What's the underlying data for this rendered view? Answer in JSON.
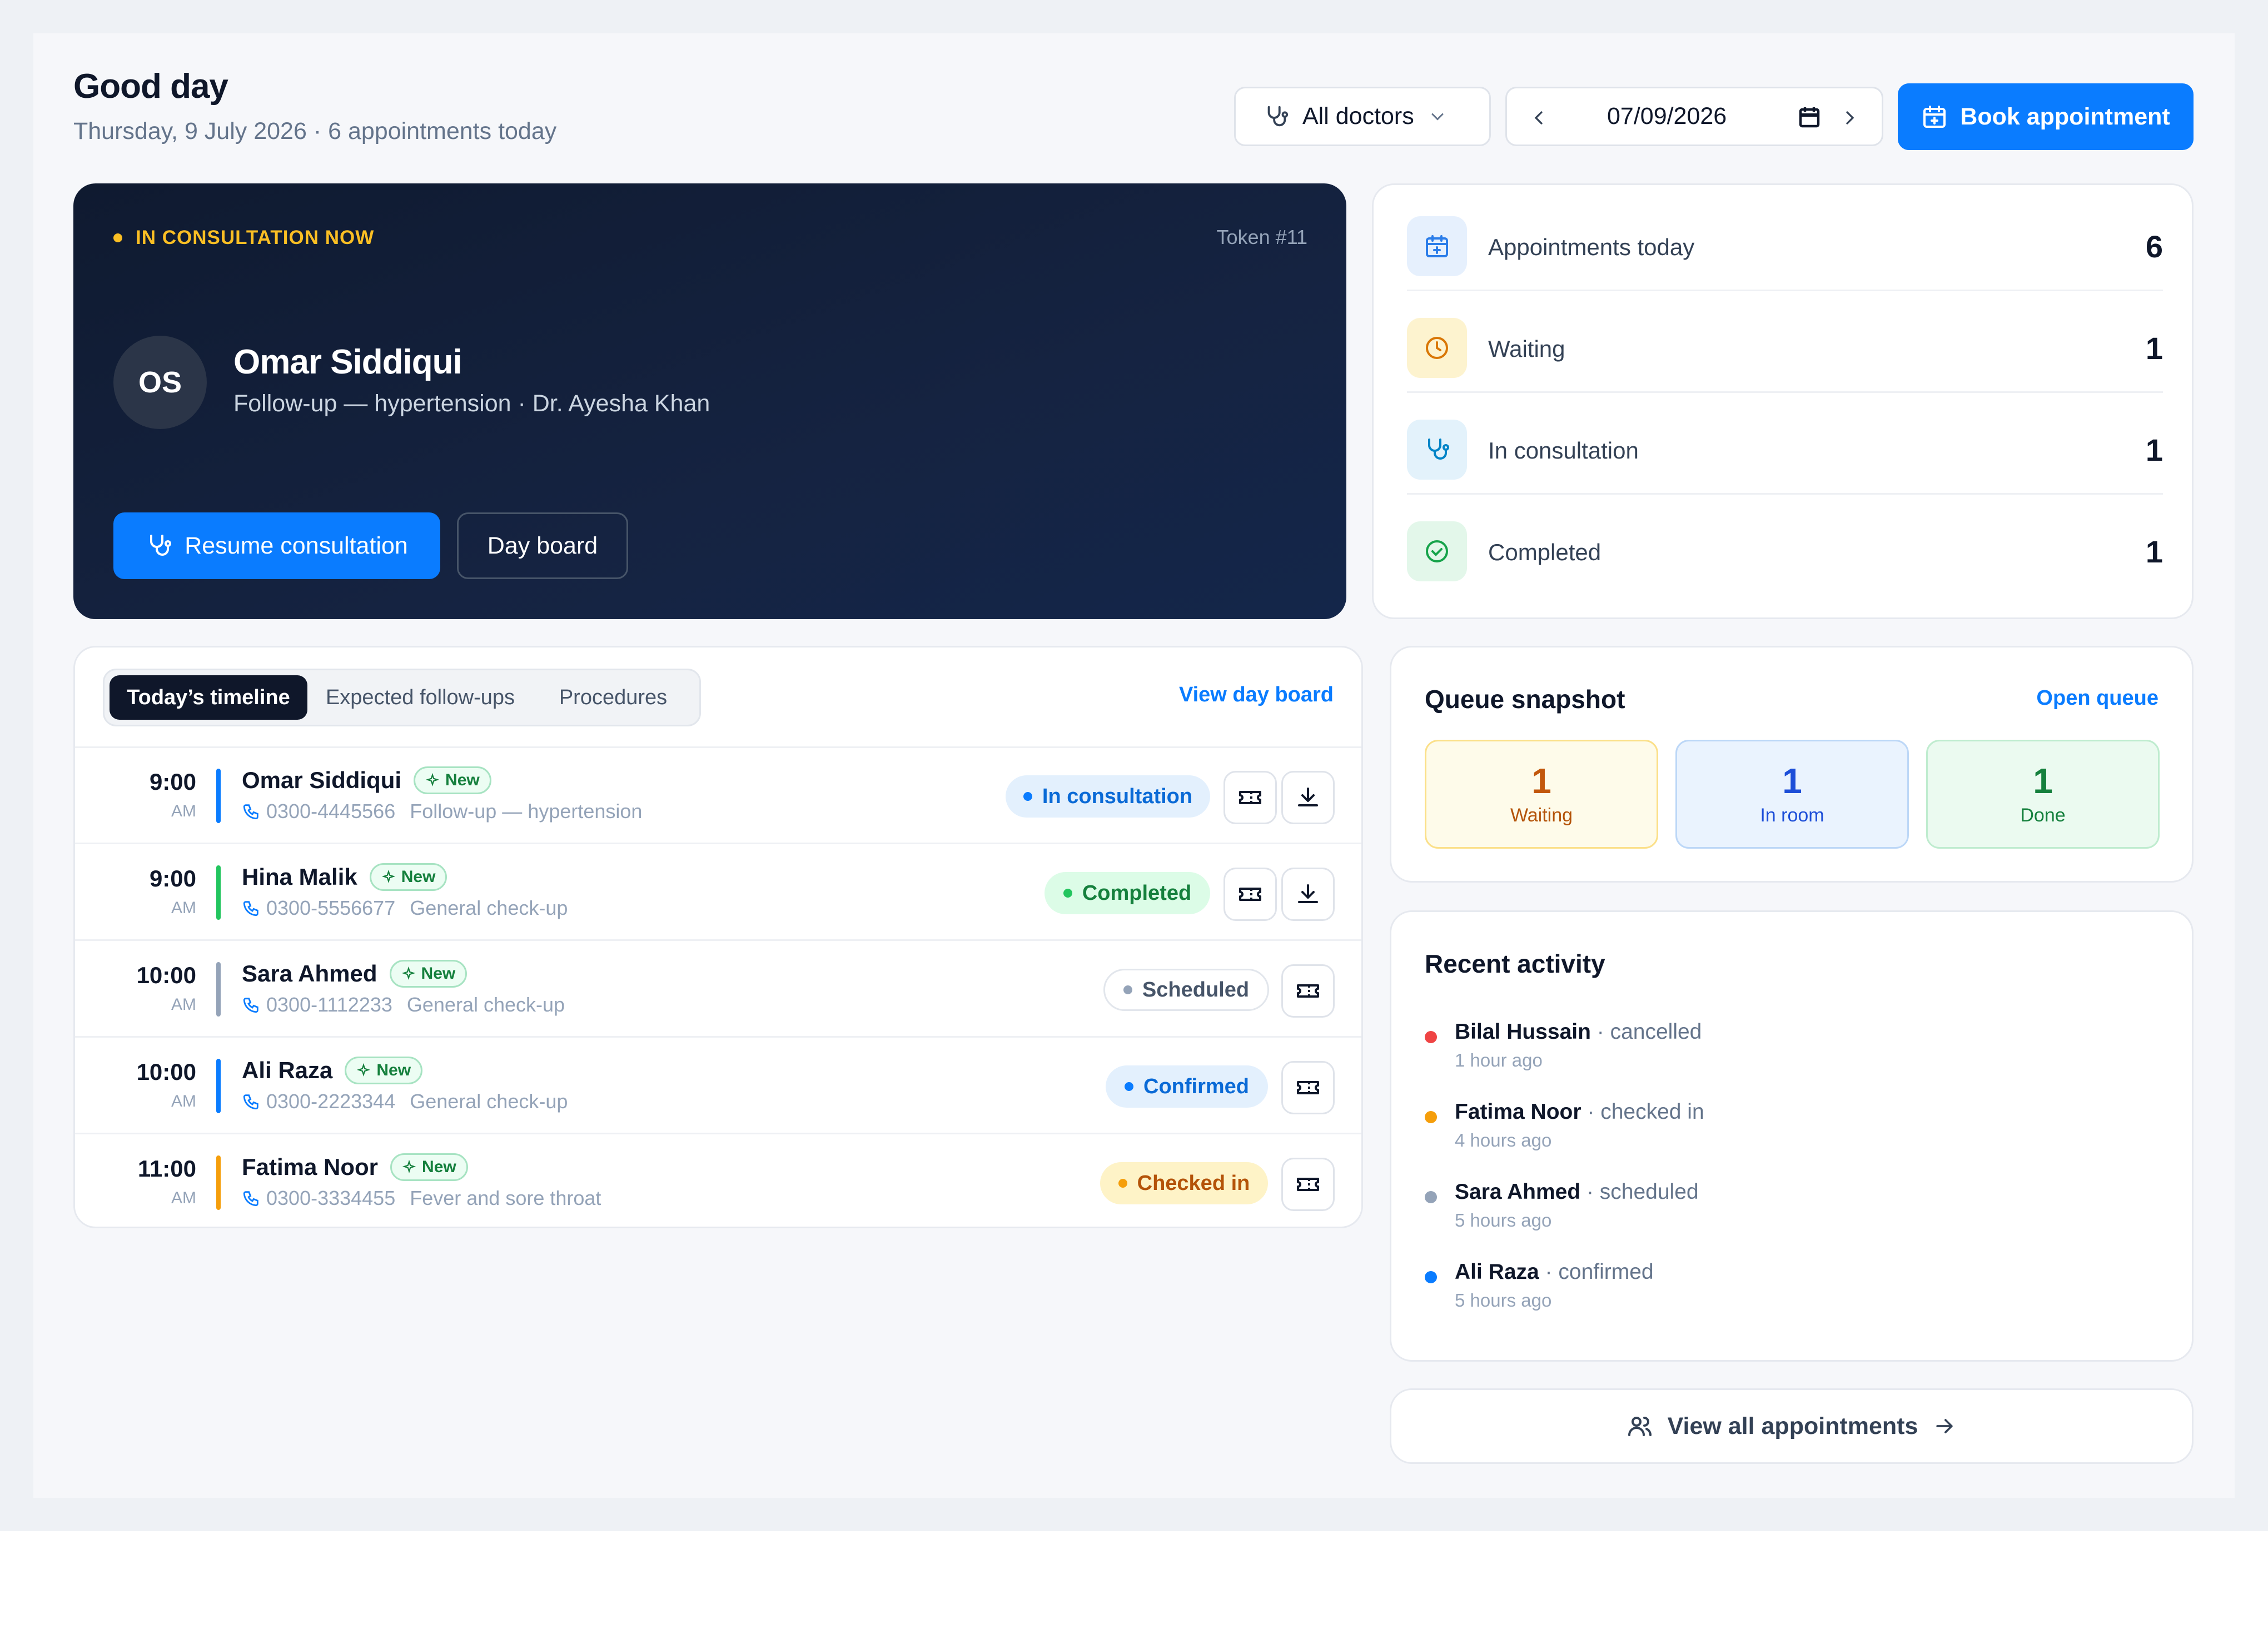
{
  "header": {
    "greeting": "Good day",
    "subtitle": "Thursday, 9 July 2026 · 6 appointments today",
    "doctor_filter": "All doctors",
    "date": "07/09/2026",
    "book_label": "Book appointment"
  },
  "current": {
    "status_label": "IN CONSULTATION NOW",
    "token": "Token #11",
    "initials": "OS",
    "name": "Omar Siddiqui",
    "description": "Follow-up — hypertension · Dr. Ayesha Khan",
    "resume_label": "Resume consultation",
    "dayboard_label": "Day board"
  },
  "stats": [
    {
      "label": "Appointments today",
      "value": "6",
      "icon": "calendar-plus-icon",
      "color": "#2b7de9"
    },
    {
      "label": "Waiting",
      "value": "1",
      "icon": "clock-icon",
      "color": "#d97706"
    },
    {
      "label": "In consultation",
      "value": "1",
      "icon": "stethoscope-icon",
      "color": "#0284c7"
    },
    {
      "label": "Completed",
      "value": "1",
      "icon": "check-circle-icon",
      "color": "#16a34a"
    }
  ],
  "timeline": {
    "tabs": [
      "Today’s timeline",
      "Expected follow-ups",
      "Procedures"
    ],
    "active_tab": "Today’s timeline",
    "view_day_board": "View day board",
    "new_label": "New",
    "rows": [
      {
        "time": "9:00",
        "ampm": "AM",
        "name": "Omar Siddiqui",
        "phone": "0300-4445566",
        "reason": "Follow-up — hypertension",
        "status": "In consultation",
        "bar_color": "#0a7cff",
        "download": true
      },
      {
        "time": "9:00",
        "ampm": "AM",
        "name": "Hina Malik",
        "phone": "0300-5556677",
        "reason": "General check-up",
        "status": "Completed",
        "bar_color": "#22c55e",
        "download": true
      },
      {
        "time": "10:00",
        "ampm": "AM",
        "name": "Sara Ahmed",
        "phone": "0300-1112233",
        "reason": "General check-up",
        "status": "Scheduled",
        "bar_color": "#94a3b8",
        "download": false
      },
      {
        "time": "10:00",
        "ampm": "AM",
        "name": "Ali Raza",
        "phone": "0300-2223344",
        "reason": "General check-up",
        "status": "Confirmed",
        "bar_color": "#0a7cff",
        "download": false
      },
      {
        "time": "11:00",
        "ampm": "AM",
        "name": "Fatima Noor",
        "phone": "0300-3334455",
        "reason": "Fever and sore throat",
        "status": "Checked in",
        "bar_color": "#f59e0b",
        "download": false
      }
    ]
  },
  "queue": {
    "title": "Queue snapshot",
    "open_label": "Open queue",
    "boxes": [
      {
        "value": "1",
        "label": "Waiting"
      },
      {
        "value": "1",
        "label": "In room"
      },
      {
        "value": "1",
        "label": "Done"
      }
    ]
  },
  "activity": {
    "title": "Recent activity",
    "items": [
      {
        "name": "Bilal Hussain",
        "action": " · cancelled",
        "time": "1 hour ago",
        "color": "#ef4444"
      },
      {
        "name": "Fatima Noor",
        "action": " · checked in",
        "time": "4 hours ago",
        "color": "#f59e0b"
      },
      {
        "name": "Sara Ahmed",
        "action": " · scheduled",
        "time": "5 hours ago",
        "color": "#94a3b8"
      },
      {
        "name": "Ali Raza",
        "action": " · confirmed",
        "time": "5 hours ago",
        "color": "#0a7cff"
      }
    ]
  },
  "view_all_label": "View all appointments"
}
